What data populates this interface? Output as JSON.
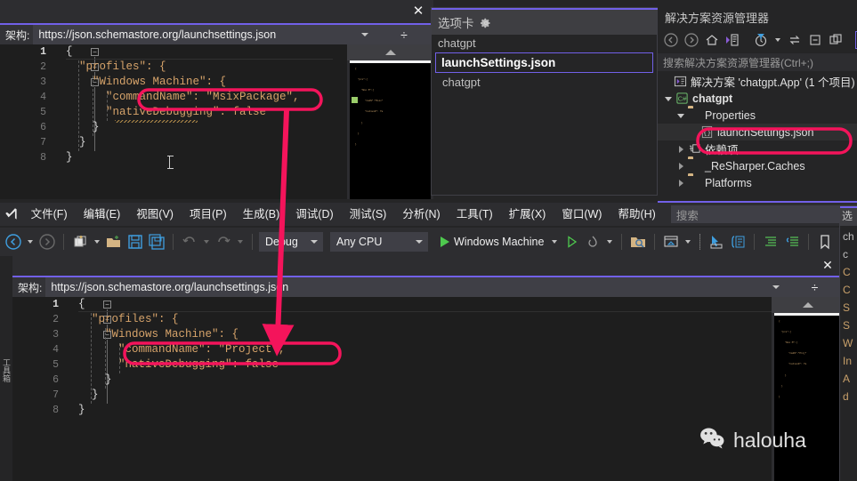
{
  "top_editor": {
    "close_label": "✕",
    "schema_label": "架构:",
    "schema_value": "https://json.schemastore.org/launchsettings.json",
    "split_icon": "÷",
    "line_numbers": [
      "1",
      "2",
      "3",
      "4",
      "5",
      "6",
      "7",
      "8"
    ],
    "code_lines": [
      {
        "n": "1",
        "text": "{"
      },
      {
        "n": "2",
        "text": "  \"profiles\": {"
      },
      {
        "n": "3",
        "text": "    \"Windows Machine\": {"
      },
      {
        "n": "4",
        "text": "      \"commandName\": \"MsixPackage\","
      },
      {
        "n": "5",
        "text": "      \"nativeDebugging\": false"
      },
      {
        "n": "6",
        "text": "    }"
      },
      {
        "n": "7",
        "text": "  }"
      },
      {
        "n": "8",
        "text": "}"
      }
    ],
    "highlighted_value": "MsixPackage",
    "minimap_arrow": "▲"
  },
  "tabs_popup": {
    "title": "选项卡",
    "gear_icon": "gear-icon",
    "items": [
      {
        "label": "chatgpt",
        "selected": false,
        "indent": 0
      },
      {
        "label": "launchSettings.json",
        "selected": true,
        "indent": 0
      },
      {
        "label": "chatgpt",
        "selected": false,
        "indent": 1
      }
    ]
  },
  "solution_explorer": {
    "title": "解决方案资源管理器",
    "search_placeholder": "搜索解决方案资源管理器(Ctrl+;)",
    "toolbar_icons": [
      "back-icon",
      "forward-icon",
      "home-icon",
      "sync-with-active-document-icon",
      "pending-changes-filter-icon",
      "chevron-down-icon",
      "switch-views-icon",
      "collapse-all-icon",
      "show-all-files-icon",
      "properties-icon"
    ],
    "tree": [
      {
        "label": "解决方案 'chatgpt.App' (1 个项目)",
        "indent": 0,
        "icon": "solution-icon",
        "expander": "none",
        "bold": false
      },
      {
        "label": "chatgpt",
        "indent": 1,
        "icon": "csharp-project-icon",
        "expander": "open",
        "bold": true
      },
      {
        "label": "Properties",
        "indent": 2,
        "icon": "properties-folder-icon",
        "expander": "open",
        "bold": false
      },
      {
        "label": "launchSettings.json",
        "indent": 3,
        "icon": "json-file-icon",
        "expander": "none",
        "bold": false,
        "highlighted": true
      },
      {
        "label": "依赖项",
        "indent": 2,
        "icon": "dependencies-icon",
        "expander": "closed",
        "bold": false
      },
      {
        "label": "_ReSharper.Caches",
        "indent": 2,
        "icon": "folder-icon",
        "expander": "closed",
        "bold": false
      },
      {
        "label": "Platforms",
        "indent": 2,
        "icon": "folder-icon",
        "expander": "closed",
        "bold": false
      }
    ]
  },
  "menubar": {
    "logo": "visual-studio-logo",
    "items": [
      "文件(F)",
      "编辑(E)",
      "视图(V)",
      "项目(P)",
      "生成(B)",
      "调试(D)",
      "测试(S)",
      "分析(N)",
      "工具(T)",
      "扩展(X)",
      "窗口(W)",
      "帮助(H)"
    ],
    "search_placeholder": "搜索",
    "search_icon": "magnifier-icon"
  },
  "toolbar": {
    "configuration": "Debug",
    "platform": "Any CPU",
    "run_target": "Windows Machine",
    "icons": [
      "navigate-backward-icon",
      "navigate-forward-icon",
      "new-project-icon",
      "open-file-icon",
      "save-icon",
      "save-all-icon",
      "undo-icon",
      "redo-icon",
      "start-without-debugging-icon",
      "hot-reload-icon",
      "find-in-files-icon",
      "solution-explorer-icon",
      "pointer-select-icon",
      "structure-icon",
      "increase-indent-icon",
      "decrease-indent-icon",
      "bookmark-icon",
      "prev-bookmark-icon",
      "next-bookmark-icon",
      "clear-bookmarks-icon"
    ]
  },
  "bottom_editor": {
    "vertical_tab": "工具箱",
    "close_label": "✕",
    "schema_label": "架构:",
    "schema_value": "https://json.schemastore.org/launchsettings.json",
    "split_icon": "÷",
    "code_lines": [
      {
        "n": "1",
        "text": "{"
      },
      {
        "n": "2",
        "text": "  \"profiles\": {"
      },
      {
        "n": "3",
        "text": "    \"Windows Machine\": {"
      },
      {
        "n": "4",
        "text": "      \"commandName\": \"Project\","
      },
      {
        "n": "5",
        "text": "      \"nativeDebugging\": false"
      },
      {
        "n": "6",
        "text": "    }"
      },
      {
        "n": "7",
        "text": "  }"
      },
      {
        "n": "8",
        "text": "}"
      }
    ],
    "highlighted_value": "Project",
    "minimap_arrow": "▲"
  },
  "right_popup": {
    "title": "选",
    "items": [
      "ch",
      "c",
      "C",
      "C",
      "S",
      "S",
      "W",
      "In",
      "A",
      "d"
    ]
  },
  "watermark": {
    "text": "halouha",
    "icon": "wechat-icon"
  },
  "annotations": {
    "accent_color": "#f4145b",
    "boxes": [
      {
        "name": "top-commandname-box"
      },
      {
        "name": "solution-launchsettings-box"
      },
      {
        "name": "bottom-commandname-box"
      }
    ],
    "arrow": {
      "name": "change-arrow",
      "from": "top-commandname-box",
      "to": "bottom-commandname-box"
    }
  }
}
